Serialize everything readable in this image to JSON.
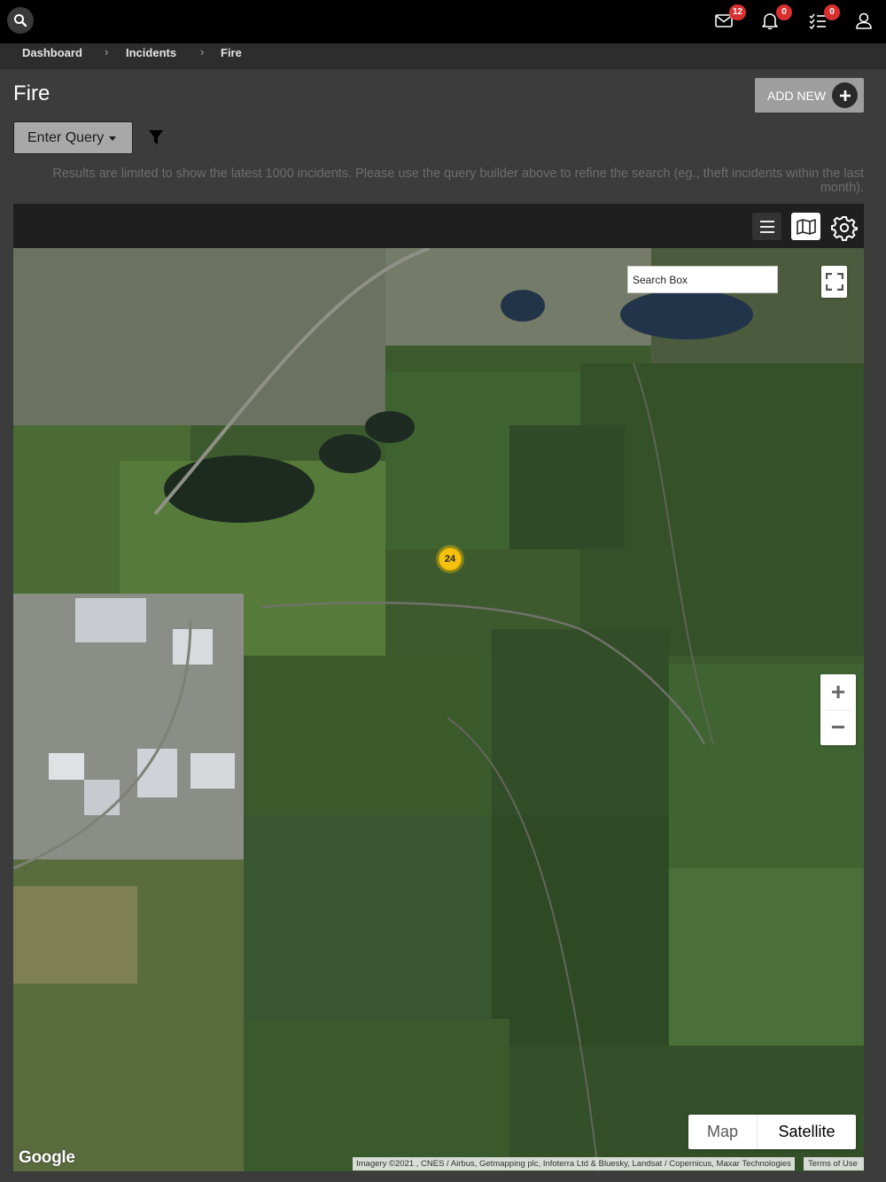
{
  "header": {
    "icons": [
      "search-icon",
      "envelope-icon",
      "bell-icon",
      "task-list-icon",
      "user-icon"
    ],
    "badges": {
      "messages": "12",
      "notifications": "0",
      "tasks": "0"
    }
  },
  "breadcrumb": {
    "items": [
      "Dashboard",
      "Incidents",
      "Fire"
    ],
    "separator": "›"
  },
  "page": {
    "title": "Fire",
    "add_new_label": "ADD NEW",
    "query_label": "Enter Query",
    "notice": "Results are limited to show the latest 1000 incidents. Please use the query builder above to refine the search (eg., theft incidents within the last month)."
  },
  "map": {
    "search_placeholder": "Search Box",
    "cluster_count": "24",
    "zoom_in": "+",
    "zoom_out": "−",
    "type_map": "Map",
    "type_satellite": "Satellite",
    "active_type": "Satellite",
    "logo": "Google",
    "attribution": "Imagery ©2021 , CNES / Airbus, Getmapping plc, Infoterra Ltd & Bluesky, Landsat / Copernicus, Maxar Technologies",
    "terms": "Terms of Use"
  },
  "colors": {
    "badge": "#d9302f",
    "cluster": "#f4c20d",
    "topbar": "#000000",
    "page_bg": "#3c3c3c"
  }
}
